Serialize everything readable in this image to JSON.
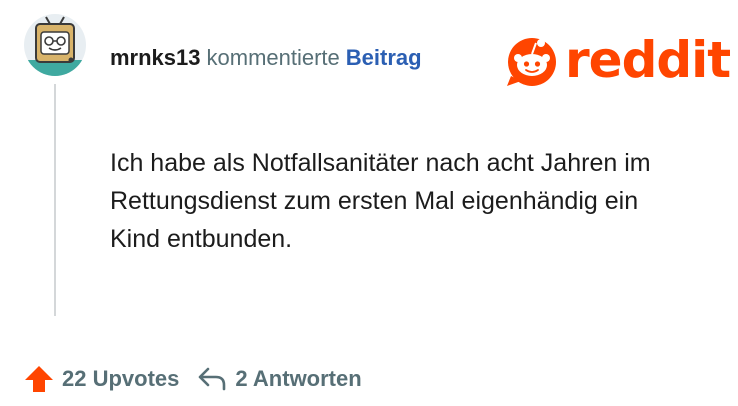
{
  "comment": {
    "author": "mrnks13",
    "action_text": "kommentierte",
    "post_link": "Beitrag",
    "body": "Ich habe als Notfallsanitäter nach acht Jahren im Rettungsdienst zum ersten Mal eigenhändig ein Kind entbunden."
  },
  "brand": {
    "wordmark": "reddit",
    "color": "#ff4500"
  },
  "footer": {
    "upvotes_label": "22 Upvotes",
    "replies_label": "2 Antworten"
  },
  "icons": {
    "avatar": "avatar",
    "logo": "reddit-snoo-icon",
    "upvote": "upvote-arrow-icon",
    "reply": "reply-arrow-icon"
  }
}
